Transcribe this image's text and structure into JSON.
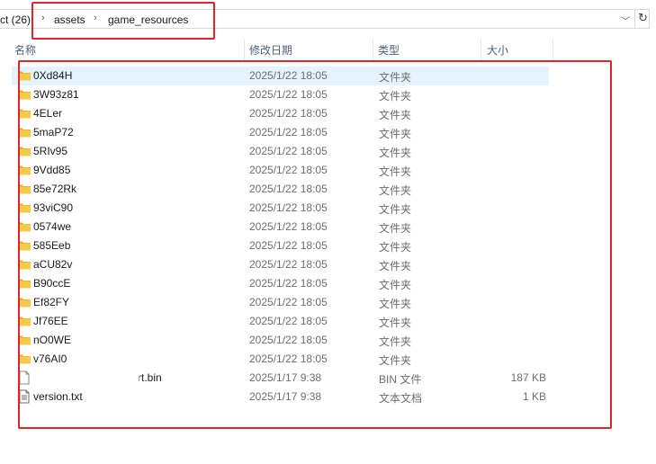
{
  "address_bar": {
    "segments": [
      "ct (26)",
      "assets",
      "game_resources"
    ],
    "separator": "›",
    "dropdown": "﹀",
    "refresh": "↻"
  },
  "columns": {
    "name": "名称",
    "date": "修改日期",
    "type": "类型",
    "size": "大小"
  },
  "files": [
    {
      "name": "0Xd84H",
      "date": "2025/1/22 18:05",
      "type": "文件夹",
      "size": "",
      "kind": "folder",
      "selected": true
    },
    {
      "name": "3W93z81",
      "date": "2025/1/22 18:05",
      "type": "文件夹",
      "size": "",
      "kind": "folder"
    },
    {
      "name": "4ELer",
      "date": "2025/1/22 18:05",
      "type": "文件夹",
      "size": "",
      "kind": "folder"
    },
    {
      "name": "5maP72",
      "date": "2025/1/22 18:05",
      "type": "文件夹",
      "size": "",
      "kind": "folder"
    },
    {
      "name": "5RIv95",
      "date": "2025/1/22 18:05",
      "type": "文件夹",
      "size": "",
      "kind": "folder"
    },
    {
      "name": "9Vdd85",
      "date": "2025/1/22 18:05",
      "type": "文件夹",
      "size": "",
      "kind": "folder"
    },
    {
      "name": "85e72Rk",
      "date": "2025/1/22 18:05",
      "type": "文件夹",
      "size": "",
      "kind": "folder"
    },
    {
      "name": "93viC90",
      "date": "2025/1/22 18:05",
      "type": "文件夹",
      "size": "",
      "kind": "folder"
    },
    {
      "name": "0574we",
      "date": "2025/1/22 18:05",
      "type": "文件夹",
      "size": "",
      "kind": "folder"
    },
    {
      "name": "585Eeb",
      "date": "2025/1/22 18:05",
      "type": "文件夹",
      "size": "",
      "kind": "folder"
    },
    {
      "name": "aCU82v",
      "date": "2025/1/22 18:05",
      "type": "文件夹",
      "size": "",
      "kind": "folder"
    },
    {
      "name": "B90ccE",
      "date": "2025/1/22 18:05",
      "type": "文件夹",
      "size": "",
      "kind": "folder"
    },
    {
      "name": "Ef82FY",
      "date": "2025/1/22 18:05",
      "type": "文件夹",
      "size": "",
      "kind": "folder"
    },
    {
      "name": "Jf76EE",
      "date": "2025/1/22 18:05",
      "type": "文件夹",
      "size": "",
      "kind": "folder"
    },
    {
      "name": "nO0WE",
      "date": "2025/1/22 18:05",
      "type": "文件夹",
      "size": "",
      "kind": "folder"
    },
    {
      "name": "v76AI0",
      "date": "2025/1/22 18:05",
      "type": "文件夹",
      "size": "",
      "kind": "folder"
    },
    {
      "name": "rt.bin",
      "date": "2025/1/17 9:38",
      "type": "BIN 文件",
      "size": "187 KB",
      "kind": "file",
      "obscured": true
    },
    {
      "name": "version.txt",
      "date": "2025/1/17 9:38",
      "type": "文本文档",
      "size": "1 KB",
      "kind": "textfile"
    }
  ],
  "colors": {
    "highlight": "#e0242b",
    "selection": "#e5f3ff",
    "folder": "#f3c13a"
  }
}
